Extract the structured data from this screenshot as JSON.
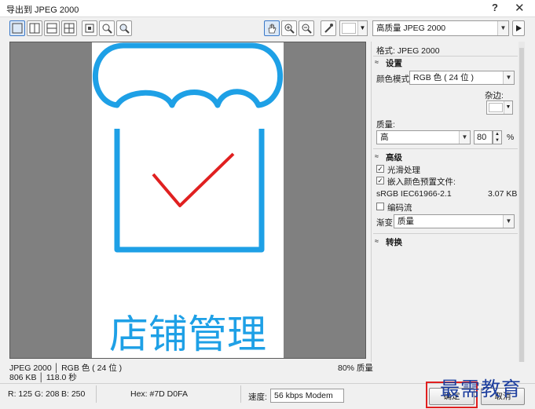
{
  "window": {
    "title": "导出到 JPEG 2000",
    "help_glyph": "?",
    "close_glyph": "✕"
  },
  "toolbar": {
    "preset_value": "高质量 JPEG 2000",
    "icons": [
      "single-view-icon",
      "two-view-vertical-icon",
      "two-view-horizontal-icon",
      "four-view-icon",
      "fit-page-icon",
      "zoom-to-fit-icon",
      "zoom-full-icon",
      "hand-icon",
      "zoom-in-icon",
      "zoom-out-icon",
      "eyedropper-icon",
      "color-swatch-icon",
      "play-icon"
    ]
  },
  "canvas": {
    "caption": "店铺管理",
    "colors": {
      "stroke": "#1ea0e6",
      "check": "#e02020",
      "text": "#1ea0e6"
    }
  },
  "panel": {
    "format_label": "格式: JPEG 2000",
    "settings": {
      "heading": "设置",
      "color_mode_label": "颜色模式:",
      "color_mode_value": "RGB 色 ( 24 位 )",
      "matte_label": "杂边:",
      "quality_label": "质量:",
      "quality_value": "高",
      "quality_number": "80",
      "quality_unit": "%"
    },
    "advanced": {
      "heading": "高级",
      "smooth_label": "光滑处理",
      "smooth_checked": true,
      "embed_label": "嵌入颜色预置文件:",
      "embed_checked": true,
      "profile_name": "sRGB IEC61966-2.1",
      "profile_size": "3.07 KB",
      "codestream_label": "编码流",
      "codestream_checked": false,
      "progression_label": "渐变:",
      "progression_value": "质量"
    },
    "transform": {
      "heading": "转换"
    }
  },
  "status": {
    "line1_left": "JPEG 2000 │ RGB 色 ( 24 位 )",
    "line1_right": "80% 质量",
    "line2_left": "806 KB │ 118.0 秒",
    "r": "R: 125",
    "g": "G: 208",
    "b": "B: 250",
    "hex": "Hex: #7D D0FA",
    "speed_label": "速度:",
    "speed_value": "56 kbps Modem"
  },
  "buttons": {
    "ok": "确定",
    "cancel": "取消"
  },
  "watermark": "最需教育"
}
